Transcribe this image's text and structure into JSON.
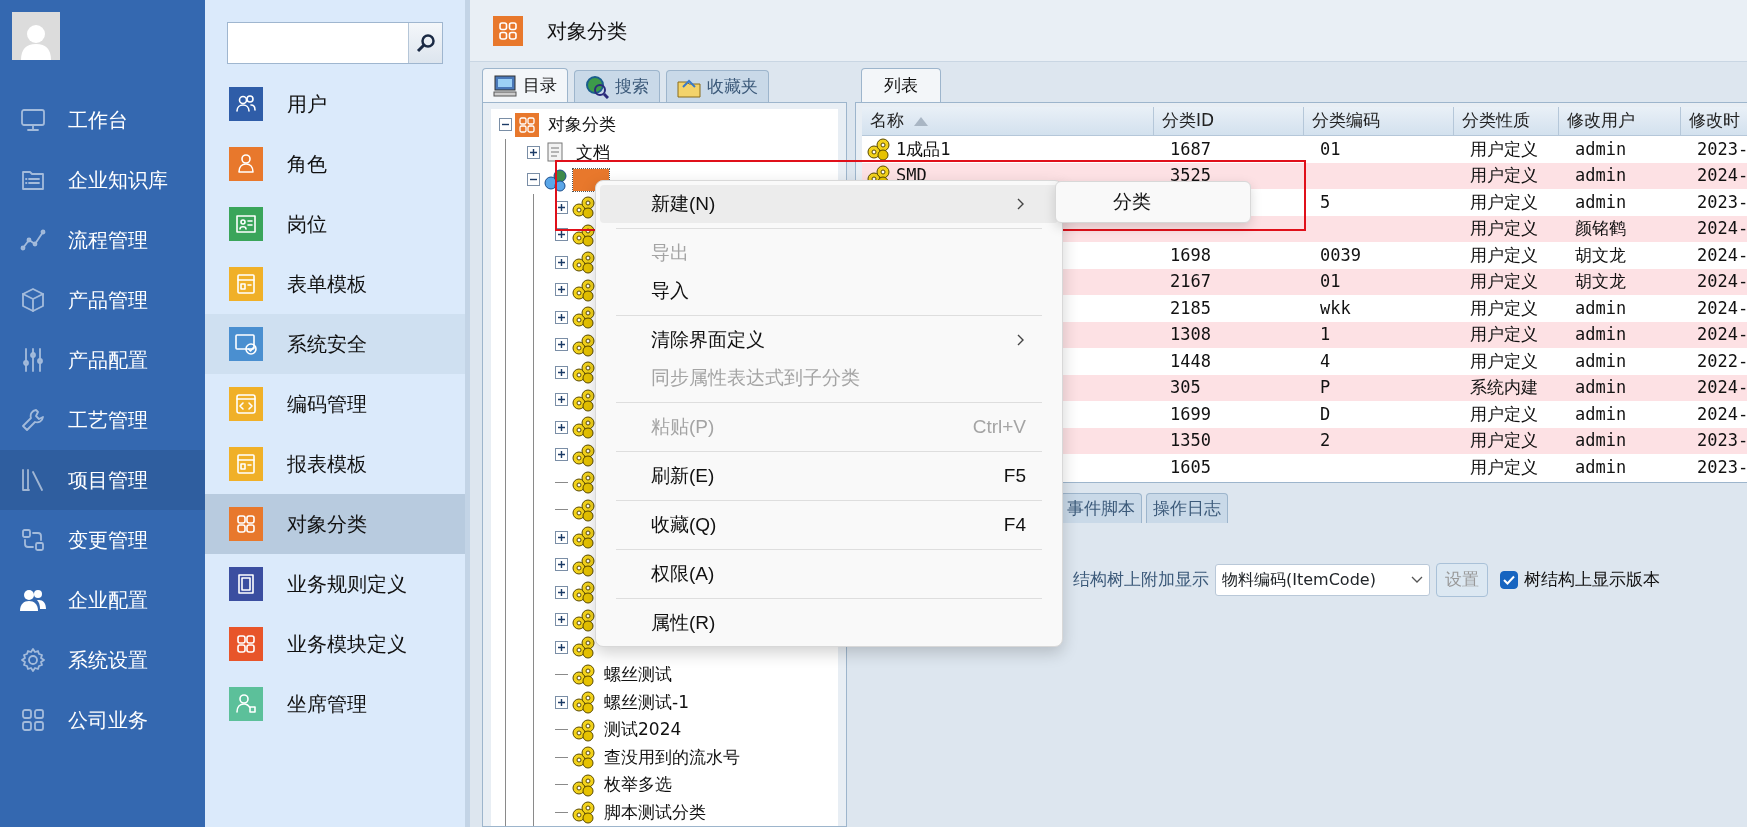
{
  "nav": {
    "items": [
      {
        "label": "工作台",
        "selected": false,
        "highlighted": false
      },
      {
        "label": "企业知识库",
        "selected": false,
        "highlighted": false
      },
      {
        "label": "流程管理",
        "selected": false,
        "highlighted": false
      },
      {
        "label": "产品管理",
        "selected": false,
        "highlighted": false
      },
      {
        "label": "产品配置",
        "selected": false,
        "highlighted": false
      },
      {
        "label": "工艺管理",
        "selected": false,
        "highlighted": false
      },
      {
        "label": "项目管理",
        "selected": false,
        "highlighted": true
      },
      {
        "label": "变更管理",
        "selected": false,
        "highlighted": false
      },
      {
        "label": "企业配置",
        "selected": true,
        "highlighted": false
      },
      {
        "label": "系统设置",
        "selected": false,
        "highlighted": false
      },
      {
        "label": "公司业务",
        "selected": false,
        "highlighted": false
      }
    ]
  },
  "module_menu": {
    "items": [
      {
        "label": "用户",
        "color": "#2f5da8",
        "selected": false,
        "hovered": false
      },
      {
        "label": "角色",
        "color": "#e8782c",
        "selected": false,
        "hovered": false
      },
      {
        "label": "岗位",
        "color": "#3aa55a",
        "selected": false,
        "hovered": false
      },
      {
        "label": "表单模板",
        "color": "#f0b028",
        "selected": false,
        "hovered": false
      },
      {
        "label": "系统安全",
        "color": "#4a8fd0",
        "selected": false,
        "hovered": true
      },
      {
        "label": "编码管理",
        "color": "#f0b028",
        "selected": false,
        "hovered": false
      },
      {
        "label": "报表模板",
        "color": "#f0b028",
        "selected": false,
        "hovered": false
      },
      {
        "label": "对象分类",
        "color": "#e8782c",
        "selected": true,
        "hovered": false
      },
      {
        "label": "业务规则定义",
        "color": "#3b4ea0",
        "selected": false,
        "hovered": false
      },
      {
        "label": "业务模块定义",
        "color": "#e8552a",
        "selected": false,
        "hovered": false
      },
      {
        "label": "坐席管理",
        "color": "#5cc09a",
        "selected": false,
        "hovered": false
      }
    ]
  },
  "page": {
    "title": "对象分类"
  },
  "left_tabs": [
    {
      "label": "目录",
      "selected": true
    },
    {
      "label": "搜索",
      "selected": false
    },
    {
      "label": "收藏夹",
      "selected": false
    }
  ],
  "tree": {
    "root": {
      "label": "对象分类",
      "kind": "category",
      "expanded": true,
      "selected": false,
      "children": [
        {
          "label": "文档",
          "kind": "document",
          "expanded": false,
          "selected": false
        },
        {
          "kind": "globe",
          "expanded": true,
          "selected": true,
          "children": [
            {
              "kind": "gear",
              "expanded": false,
              "selected": false
            },
            {
              "kind": "gear",
              "expanded": false,
              "selected": false
            },
            {
              "kind": "gear",
              "expanded": false,
              "selected": false
            },
            {
              "kind": "gear",
              "expanded": false,
              "selected": false
            },
            {
              "kind": "gear",
              "expanded": false,
              "selected": false
            },
            {
              "kind": "gear",
              "expanded": false,
              "selected": false
            },
            {
              "kind": "gear",
              "expanded": false,
              "selected": false
            },
            {
              "kind": "gear",
              "expanded": false,
              "selected": false
            },
            {
              "kind": "gear",
              "expanded": false,
              "selected": false
            },
            {
              "kind": "gear",
              "expanded": false,
              "selected": false
            },
            {
              "kind": "gear",
              "selected": false
            },
            {
              "kind": "gear",
              "selected": false
            },
            {
              "kind": "gear",
              "expanded": false,
              "selected": false
            },
            {
              "kind": "gear",
              "expanded": false,
              "selected": false
            },
            {
              "kind": "gear",
              "expanded": false,
              "selected": false
            },
            {
              "kind": "gear",
              "expanded": false,
              "selected": false
            },
            {
              "kind": "gear",
              "expanded": false,
              "selected": false
            },
            {
              "label": "螺丝测试",
              "kind": "gear",
              "selected": false
            },
            {
              "label": "螺丝测试-1",
              "kind": "gear",
              "expanded": false,
              "selected": false
            },
            {
              "label": "测试2024",
              "kind": "gear",
              "selected": false
            },
            {
              "label": "查没用到的流水号",
              "kind": "gear",
              "selected": false
            },
            {
              "label": "枚举多选",
              "kind": "gear",
              "selected": false
            },
            {
              "label": "脚本测试分类",
              "kind": "gear",
              "selected": false
            }
          ]
        }
      ]
    }
  },
  "right_tabs": [
    {
      "label": "列表",
      "selected": true
    }
  ],
  "table": {
    "columns": [
      {
        "label": "名称",
        "sort_ascending": true
      },
      {
        "label": "分类ID"
      },
      {
        "label": "分类编码"
      },
      {
        "label": "分类性质"
      },
      {
        "label": "修改用户"
      },
      {
        "label": "修改时"
      }
    ],
    "rows": [
      {
        "cells": [
          "1成品1",
          "1687",
          "01",
          "用户定义",
          "admin",
          "2023-"
        ]
      },
      {
        "cells": [
          "SMD",
          "3525",
          null,
          "用户定义",
          "admin",
          "2024-"
        ]
      },
      {
        "cells": [
          null,
          null,
          "5",
          "用户定义",
          "admin",
          "2023-"
        ]
      },
      {
        "cells": [
          null,
          null,
          null,
          "用户定义",
          "颜铭鹤",
          "2024-"
        ]
      },
      {
        "cells": [
          null,
          "1698",
          "0039",
          "用户定义",
          "胡文龙",
          "2024-"
        ]
      },
      {
        "cells": [
          null,
          "2167",
          "01",
          "用户定义",
          "胡文龙",
          "2024-"
        ]
      },
      {
        "cells": [
          null,
          "2185",
          "wkk",
          "用户定义",
          "admin",
          "2024-"
        ]
      },
      {
        "cells": [
          null,
          "1308",
          "1",
          "用户定义",
          "admin",
          "2024-"
        ]
      },
      {
        "cells": [
          null,
          "1448",
          "4",
          "用户定义",
          "admin",
          "2022-"
        ]
      },
      {
        "cells": [
          null,
          "305",
          "P",
          "系统内建",
          "admin",
          "2024-"
        ]
      },
      {
        "cells": [
          null,
          "1699",
          "D",
          "用户定义",
          "admin",
          "2024-"
        ]
      },
      {
        "cells": [
          null,
          "1350",
          "2",
          "用户定义",
          "admin",
          "2023-"
        ]
      },
      {
        "cells": [
          null,
          "1605",
          null,
          "用户定义",
          "admin",
          "2023-"
        ]
      }
    ]
  },
  "bottom_tabs": [
    {
      "label": "事件脚本",
      "selected": false
    },
    {
      "label": "操作日志",
      "selected": false
    }
  ],
  "settings": {
    "label": "结构树上附加显示",
    "select_value": "物料编码(ItemCode)",
    "button": {
      "label": "设置",
      "disabled": true
    },
    "checkbox": {
      "label": "树结构上显示版本",
      "checked": true
    }
  },
  "context_menu": {
    "items": [
      {
        "kind": "item",
        "label": "新建(N)",
        "submenu": true,
        "highlighted": true,
        "disabled": false
      },
      {
        "kind": "separator"
      },
      {
        "kind": "item",
        "label": "导出",
        "submenu": false,
        "highlighted": false,
        "disabled": true
      },
      {
        "kind": "item",
        "label": "导入",
        "submenu": false,
        "highlighted": false,
        "disabled": false
      },
      {
        "kind": "separator"
      },
      {
        "kind": "item",
        "label": "清除界面定义",
        "submenu": true,
        "highlighted": false,
        "disabled": false
      },
      {
        "kind": "item",
        "label": "同步属性表达式到子分类",
        "submenu": false,
        "highlighted": false,
        "disabled": true
      },
      {
        "kind": "separator"
      },
      {
        "kind": "item",
        "label": "粘贴(P)",
        "shortcut": "Ctrl+V",
        "submenu": false,
        "highlighted": false,
        "disabled": true
      },
      {
        "kind": "separator"
      },
      {
        "kind": "item",
        "label": "刷新(E)",
        "shortcut": "F5",
        "submenu": false,
        "highlighted": false,
        "disabled": false
      },
      {
        "kind": "separator"
      },
      {
        "kind": "item",
        "label": "收藏(Q)",
        "shortcut": "F4",
        "submenu": false,
        "highlighted": false,
        "disabled": false
      },
      {
        "kind": "separator"
      },
      {
        "kind": "item",
        "label": "权限(A)",
        "submenu": false,
        "highlighted": false,
        "disabled": false
      },
      {
        "kind": "separator"
      },
      {
        "kind": "item",
        "label": "属性(R)",
        "submenu": false,
        "highlighted": false,
        "disabled": false
      }
    ]
  },
  "submenu": {
    "items": [
      {
        "label": "分类"
      }
    ]
  }
}
